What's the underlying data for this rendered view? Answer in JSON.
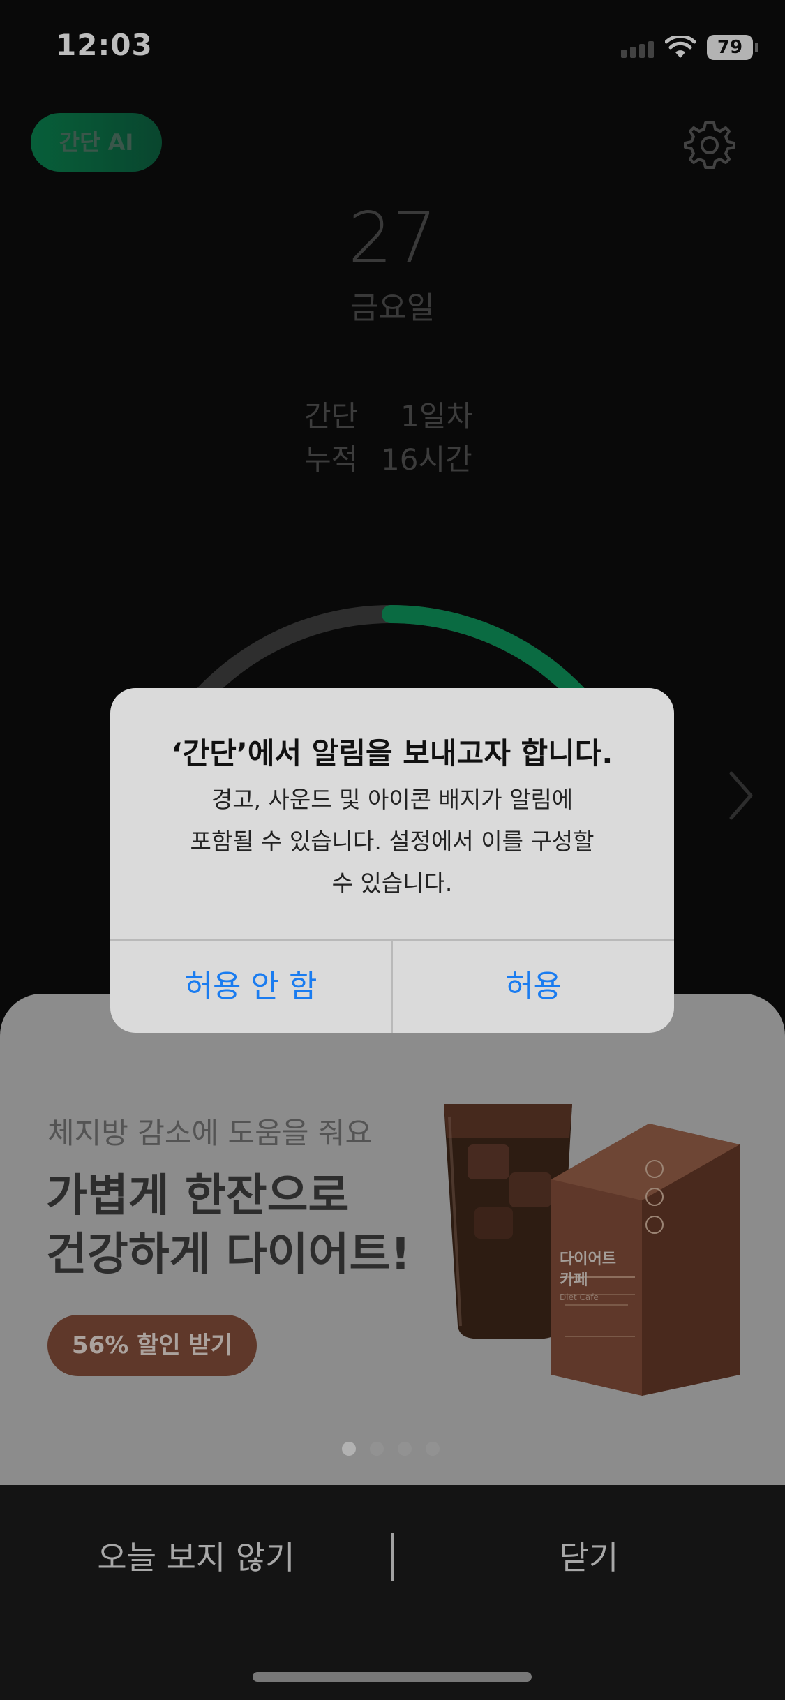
{
  "status_bar": {
    "time": "12:03",
    "battery": "79"
  },
  "header": {
    "ai_button": "간단 AI",
    "settings_icon": "gear-icon"
  },
  "date": {
    "day_number": "27",
    "weekday": "금요일"
  },
  "stats": [
    {
      "label": "간단",
      "value": "1일차"
    },
    {
      "label": "누적",
      "value": "16시간"
    }
  ],
  "progress": {
    "fraction": 0.2,
    "accent": "#0e8a55",
    "track": "#4a4a4a"
  },
  "alert": {
    "title": "‘간단’에서 알림을 보내고자 합니다.",
    "message_lines": [
      "경고, 사운드 및 아이콘 배지가 알림에",
      "포함될 수 있습니다. 설정에서 이를 구성할",
      "수 있습니다."
    ],
    "deny_label": "허용 안 함",
    "allow_label": "허용",
    "button_color": "#1a7cf0"
  },
  "promo": {
    "subtitle": "체지방 감소에 도움을 줘요",
    "title_lines": [
      "가볍게 한잔으로",
      "건강하게 다이어트!"
    ],
    "button_label": "56% 할인 받기",
    "product_name_lines": [
      "다이어트",
      "카페"
    ],
    "product_name_en": "Diet Cafe",
    "brand_color": "#7a4836",
    "page_count": 4,
    "current_page": 1
  },
  "bottom_bar": {
    "dont_show_today": "오늘 보지 않기",
    "close": "닫기"
  }
}
